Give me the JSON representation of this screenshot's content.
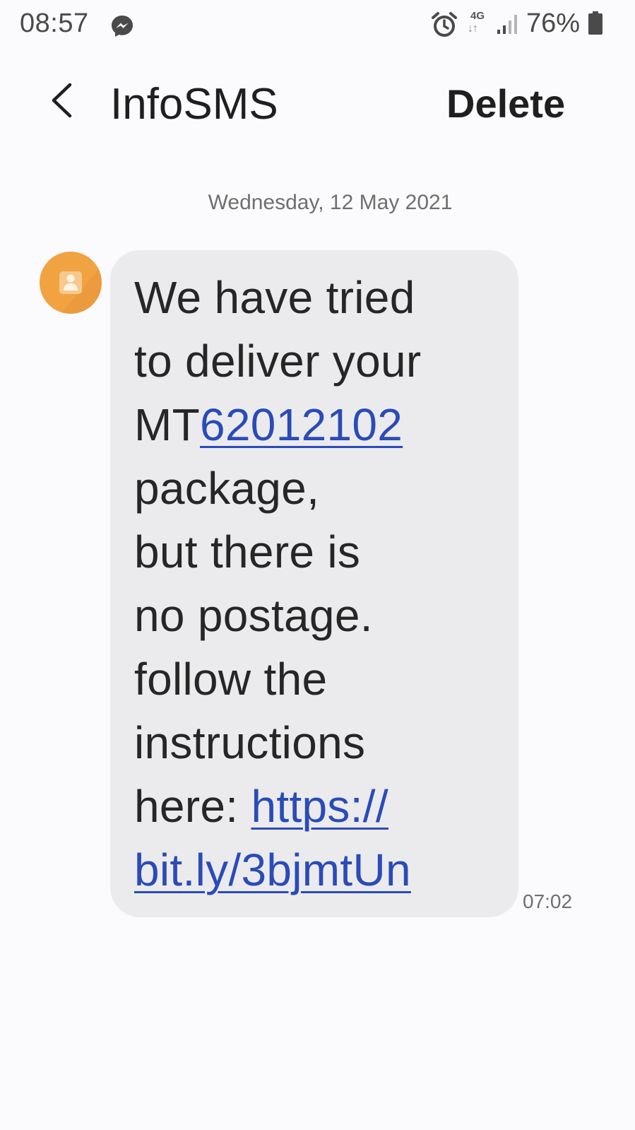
{
  "status_bar": {
    "time": "08:57",
    "network_type": "4G",
    "battery_percent": "76%",
    "icons": [
      "messenger-icon",
      "alarm-icon",
      "network-4g-icon",
      "signal-icon",
      "battery-icon"
    ]
  },
  "header": {
    "title": "InfoSMS",
    "delete_label": "Delete",
    "back_icon": "chevron-left-icon"
  },
  "conversation": {
    "date": "Wednesday, 12 May 2021",
    "messages": [
      {
        "avatar_icon": "person-icon",
        "avatar_color": "#f0a340",
        "lines": {
          "l1": "We have tried",
          "l2": "to deliver your",
          "l3_prefix": "MT",
          "l3_link": "62012102",
          "l4": "package,",
          "l5": "but there is",
          "l6": "no postage.",
          "l7": "follow the",
          "l8": "instructions",
          "l9_prefix": "here: ",
          "l9_link": "https://",
          "l10_link": "bit.ly/3bjmtUn"
        },
        "time": "07:02"
      }
    ]
  },
  "colors": {
    "background": "#fbfbfd",
    "bubble": "#ebebed",
    "link": "#2a4bb8",
    "avatar": "#f0a340"
  }
}
